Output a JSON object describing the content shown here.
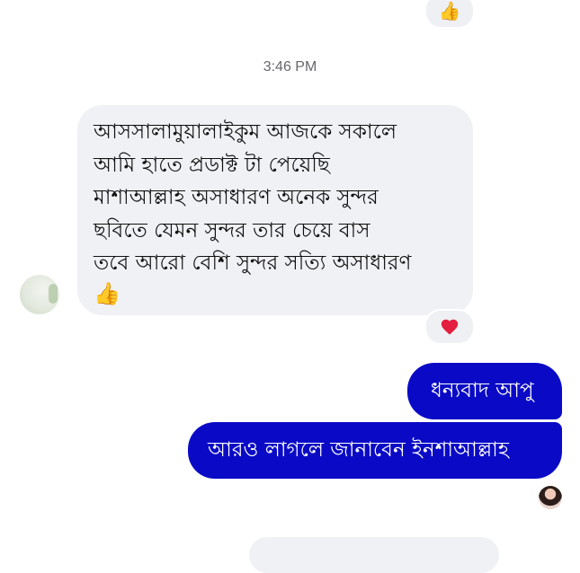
{
  "top_reaction": {
    "emoji": "👍",
    "icon": "thumbs-up-icon"
  },
  "timestamp": "3:46 PM",
  "incoming_message": {
    "lines": [
      "আসসালামুয়ালাইকুম আজকে সকালে",
      "আমি হাতে প্রডাক্ট টা পেয়েছি",
      "মাশাআল্লাহ অসাধারণ অনেক সুন্দর",
      "ছবিতে যেমন সুন্দর তার চেয়ে বাস",
      "তবে আরো বেশি সুন্দর সত্যি অসাধারণ"
    ],
    "emoji": "👍",
    "reaction": {
      "icon": "heart-icon",
      "color": "#e41e3f"
    }
  },
  "outgoing_messages": [
    {
      "text": "ধন্যবাদ আপু"
    },
    {
      "text": "আরও লাগলে জানাবেন ইনশাআল্লাহ"
    }
  ],
  "colors": {
    "outgoing_bubble": "#0a0ac6",
    "incoming_bubble": "#f0f1f5",
    "timestamp": "#65676b"
  }
}
